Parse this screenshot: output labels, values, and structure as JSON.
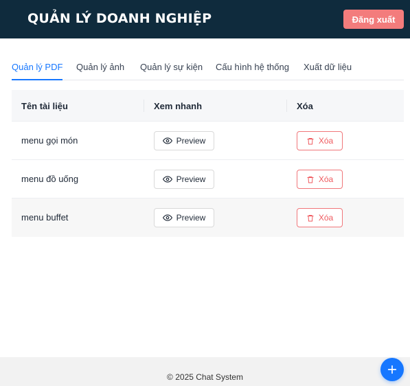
{
  "header": {
    "title": "QUẢN LÝ DOANH NGHIỆP",
    "logout_label": "Đăng xuất"
  },
  "tabs": [
    {
      "label": "Quản lý PDF",
      "active": true
    },
    {
      "label": "Quản lý ảnh",
      "active": false
    },
    {
      "label": "Quản lý sự kiện",
      "active": false
    },
    {
      "label": "Cấu hình hệ thống",
      "active": false
    },
    {
      "label": "Xuất dữ liệu",
      "active": false
    }
  ],
  "table": {
    "columns": [
      "Tên tài liệu",
      "Xem nhanh",
      "Xóa"
    ],
    "rows": [
      {
        "name": "menu gọi món",
        "preview_label": "Preview",
        "delete_label": "Xóa"
      },
      {
        "name": "menu đồ uống",
        "preview_label": "Preview",
        "delete_label": "Xóa"
      },
      {
        "name": "menu buffet",
        "preview_label": "Preview",
        "delete_label": "Xóa"
      }
    ]
  },
  "footer": {
    "text": "© 2025 Chat System"
  },
  "fab": {
    "icon": "plus-icon"
  },
  "colors": {
    "header_bg": "#0f2b3d",
    "logout_bg": "#f37c7c",
    "accent": "#1677ff",
    "danger": "#ef5a5f"
  }
}
